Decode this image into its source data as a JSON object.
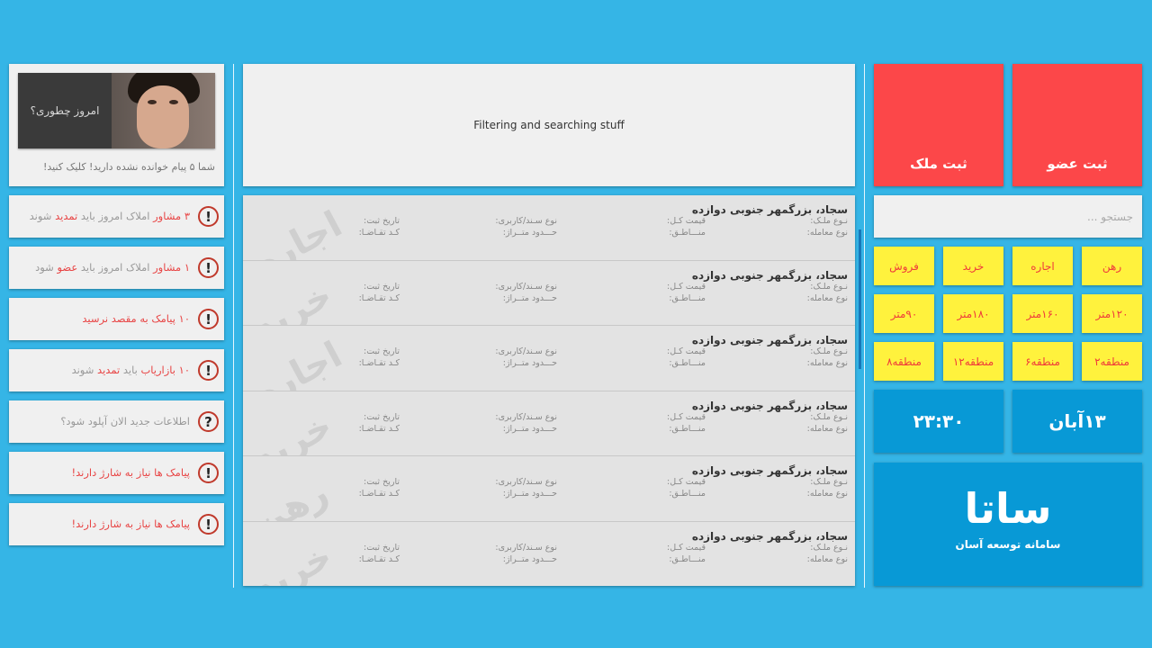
{
  "profile": {
    "greeting": "امروز چطوری؟",
    "unread_message": "شما ۵ پیام خوانده نشده دارید! کلیک کنید!"
  },
  "notifications": [
    {
      "icon": "alert-icon",
      "glyph": "!",
      "parts": [
        "۳ مشاور",
        " املاک امروز باید ",
        "تمدید",
        " شوند"
      ]
    },
    {
      "icon": "alert-icon",
      "glyph": "!",
      "parts": [
        "۱ مشاور",
        " املاک امروز باید ",
        "عضو",
        " شود"
      ]
    },
    {
      "icon": "alert-icon",
      "glyph": "!",
      "parts": [
        "۱۰ پیامک به مقصد نرسید",
        "",
        "",
        ""
      ]
    },
    {
      "icon": "alert-icon",
      "glyph": "!",
      "parts": [
        "۱۰ بازاریاب",
        " باید ",
        "تمدید",
        " شوند"
      ]
    },
    {
      "icon": "question-icon",
      "glyph": "?",
      "parts": [
        "",
        "اطلاعات جدید الان آپلود شود؟",
        "",
        ""
      ]
    },
    {
      "icon": "alert-icon",
      "glyph": "!",
      "parts": [
        "پیامک ها نیاز به شارژ دارند!",
        "",
        "",
        ""
      ]
    },
    {
      "icon": "alert-icon",
      "glyph": "!",
      "parts": [
        "پیامک ها نیاز به شارژ دارند!",
        "",
        "",
        ""
      ]
    }
  ],
  "filter_panel": {
    "text": "Filtering and searching stuff"
  },
  "results": {
    "labels": {
      "property_type": "نـوع ملـک:",
      "deal_type": "نوع معامله:",
      "total_price": "قیمت کـل:",
      "regions": "منـــاطـق:",
      "doc_type": "نوع سـند/کاربری:",
      "area_range": "حـــدود متــراژ:",
      "reg_date": "تاریخ ثبت:",
      "request_code": "کـد تقـاضـا:"
    },
    "rows": [
      {
        "title": "سجاد، بزرگمهر جنوبی دوازده",
        "watermark": "اجاره"
      },
      {
        "title": "سجاد، بزرگمهر جنوبی دوازده",
        "watermark": "خرید"
      },
      {
        "title": "سجاد، بزرگمهر جنوبی دوازده",
        "watermark": "اجاره"
      },
      {
        "title": "سجاد، بزرگمهر جنوبی دوازده",
        "watermark": "خرید"
      },
      {
        "title": "سجاد، بزرگمهر جنوبی دوازده",
        "watermark": "رهن"
      },
      {
        "title": "سجاد، بزرگمهر جنوبی دوازده",
        "watermark": "خرید"
      }
    ]
  },
  "actions": {
    "register_member": "ثبت عضو",
    "register_property": "ثبت ملک"
  },
  "search": {
    "placeholder": "جستجو ..."
  },
  "filters": {
    "deal_types": [
      "رهن",
      "اجاره",
      "خرید",
      "فروش"
    ],
    "areas": [
      "۱۲۰متر",
      "۱۶۰متر",
      "۱۸۰متر",
      "۹۰متر"
    ],
    "regions": [
      "منطقه۲",
      "منطقه۶",
      "منطقه۱۲",
      "منطقه۸"
    ]
  },
  "date": {
    "value": "۱۳آبان"
  },
  "time": {
    "value": "۲۳:۳۰"
  },
  "brand": {
    "name": "ساتا",
    "tagline": "سامانه توسعه آسان"
  },
  "colors": {
    "background": "#35b5e6",
    "red_tile": "#fc4749",
    "yellow_chip": "#fff23d",
    "blue_tile": "#0899d6"
  }
}
